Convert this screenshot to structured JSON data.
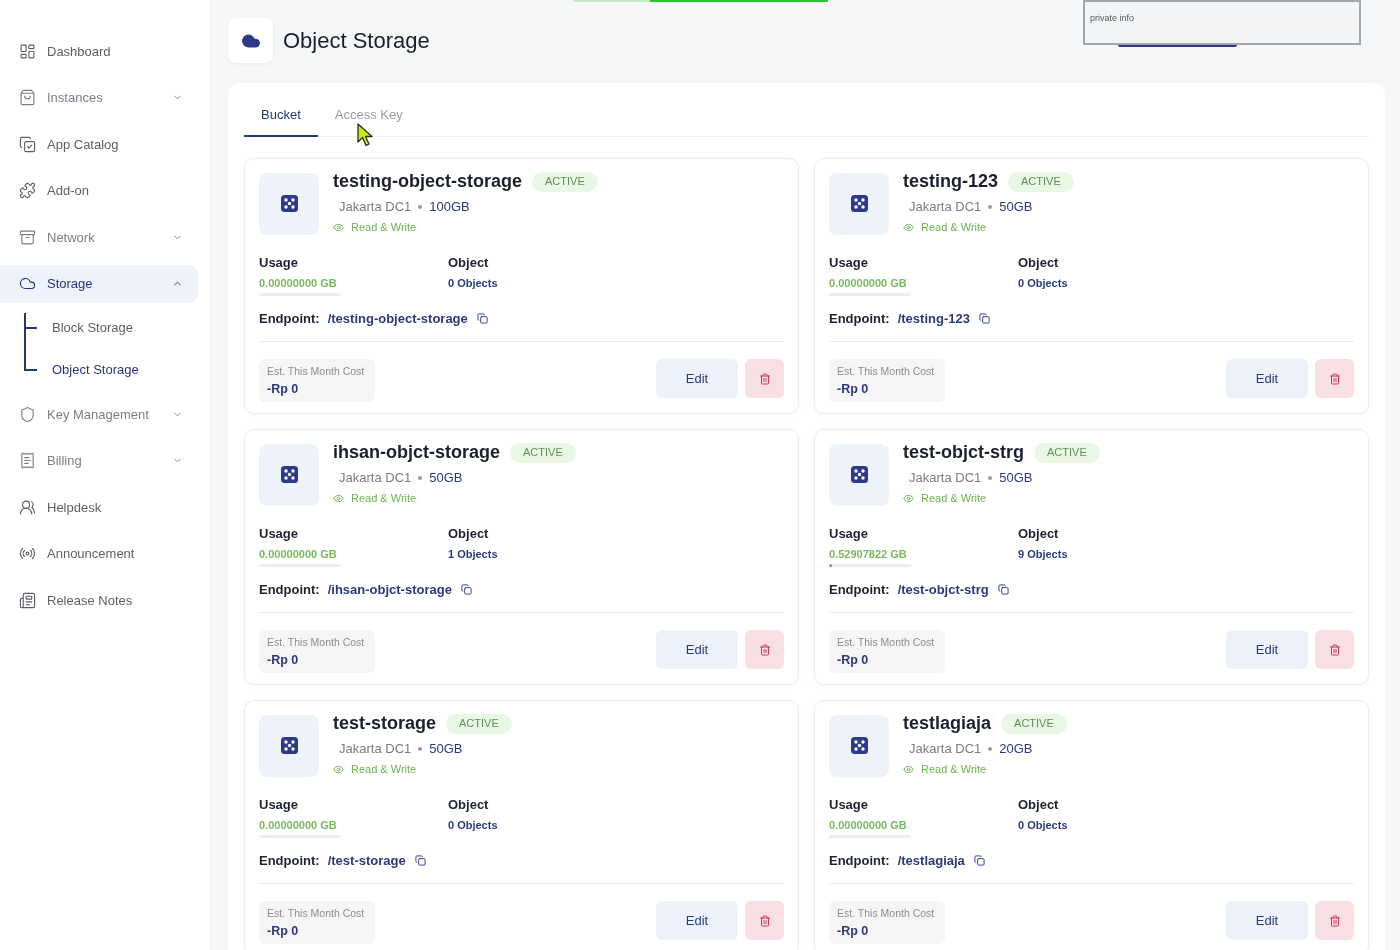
{
  "sidebar": {
    "items": [
      {
        "label": "Dashboard",
        "selected": false
      },
      {
        "label": "Instances",
        "selected": false,
        "expanded": false
      },
      {
        "label": "App Catalog",
        "selected": false
      },
      {
        "label": "Add-on",
        "selected": false
      },
      {
        "label": "Network",
        "selected": false,
        "expanded": false
      },
      {
        "label": "Storage",
        "selected": true,
        "expanded": true,
        "children": [
          {
            "label": "Block Storage",
            "selected": false
          },
          {
            "label": "Object Storage",
            "selected": true
          }
        ]
      },
      {
        "label": "Key Management",
        "selected": false,
        "expanded": false
      },
      {
        "label": "Billing",
        "selected": false,
        "expanded": false
      },
      {
        "label": "Helpdesk",
        "selected": false
      },
      {
        "label": "Announcement",
        "selected": false
      },
      {
        "label": "Release Notes",
        "selected": false
      }
    ]
  },
  "header": {
    "title": "Object Storage"
  },
  "redaction": {
    "text": "private info"
  },
  "tabs": [
    {
      "label": "Bucket",
      "selected": true
    },
    {
      "label": "Access Key",
      "selected": false
    }
  ],
  "buckets": [
    {
      "name": "testing-object-storage",
      "status": "ACTIVE",
      "location": "Jakarta DC1",
      "size": "100GB",
      "access": "Read & Write",
      "usage_label": "Usage",
      "usage": "0.00000000 GB",
      "level": 0,
      "object_label": "Object",
      "objects": "0 Objects",
      "endpoint_label": "Endpoint:",
      "endpoint": "/testing-object-storage",
      "cost_label": "Est. This Month Cost",
      "cost": "-Rp 0",
      "edit": "Edit"
    },
    {
      "name": "testing-123",
      "status": "ACTIVE",
      "location": "Jakarta DC1",
      "size": "50GB",
      "access": "Read & Write",
      "usage_label": "Usage",
      "usage": "0.00000000 GB",
      "level": 0,
      "object_label": "Object",
      "objects": "0 Objects",
      "endpoint_label": "Endpoint:",
      "endpoint": "/testing-123",
      "cost_label": "Est. This Month Cost",
      "cost": "-Rp 0",
      "edit": "Edit"
    },
    {
      "name": "ihsan-objct-storage",
      "status": "ACTIVE",
      "location": "Jakarta DC1",
      "size": "50GB",
      "access": "Read & Write",
      "usage_label": "Usage",
      "usage": "0.00000000 GB",
      "level": 0,
      "object_label": "Object",
      "objects": "1 Objects",
      "endpoint_label": "Endpoint:",
      "endpoint": "/ihsan-objct-storage",
      "cost_label": "Est. This Month Cost",
      "cost": "-Rp 0",
      "edit": "Edit"
    },
    {
      "name": "test-objct-strg",
      "status": "ACTIVE",
      "location": "Jakarta DC1",
      "size": "50GB",
      "access": "Read & Write",
      "usage_label": "Usage",
      "usage": "0.52907822 GB",
      "level": 0.04,
      "object_label": "Object",
      "objects": "9 Objects",
      "endpoint_label": "Endpoint:",
      "endpoint": "/test-objct-strg",
      "cost_label": "Est. This Month Cost",
      "cost": "-Rp 0",
      "edit": "Edit"
    },
    {
      "name": "test-storage",
      "status": "ACTIVE",
      "location": "Jakarta DC1",
      "size": "50GB",
      "access": "Read & Write",
      "usage_label": "Usage",
      "usage": "0.00000000 GB",
      "level": 0,
      "object_label": "Object",
      "objects": "0 Objects",
      "endpoint_label": "Endpoint:",
      "endpoint": "/test-storage",
      "cost_label": "Est. This Month Cost",
      "cost": "-Rp 0",
      "edit": "Edit"
    },
    {
      "name": "testlagiaja",
      "status": "ACTIVE",
      "location": "Jakarta DC1",
      "size": "20GB",
      "access": "Read & Write",
      "usage_label": "Usage",
      "usage": "0.00000000 GB",
      "level": 0,
      "object_label": "Object",
      "objects": "0 Objects",
      "endpoint_label": "Endpoint:",
      "endpoint": "/testlagiaja",
      "cost_label": "Est. This Month Cost",
      "cost": "-Rp 0",
      "edit": "Edit"
    }
  ]
}
